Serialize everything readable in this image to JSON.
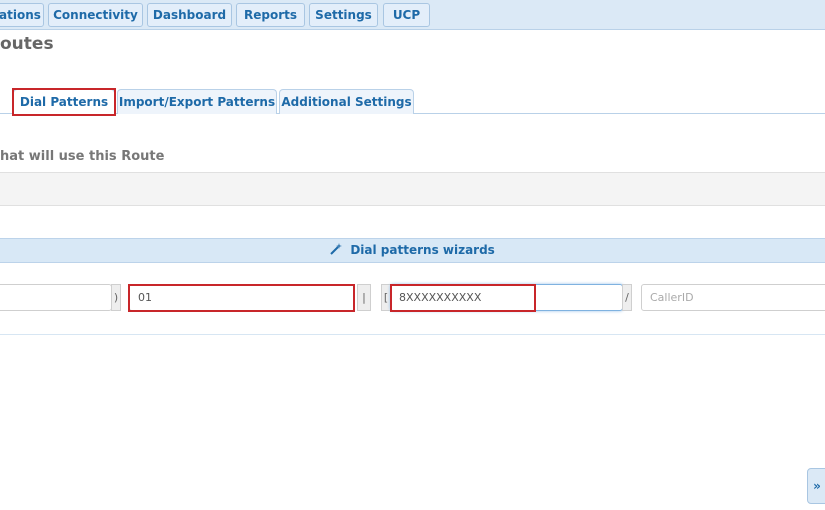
{
  "nav": {
    "items": [
      "ations",
      "Connectivity",
      "Dashboard",
      "Reports",
      "Settings",
      "UCP"
    ]
  },
  "page": {
    "title": "outes"
  },
  "tabs": {
    "dial_patterns": "Dial Patterns",
    "import_export": "Import/Export Patterns",
    "additional": "Additional Settings"
  },
  "section": {
    "heading": "hat will use this Route"
  },
  "wizard": {
    "label": "Dial patterns wizards",
    "icon": "magic-wand-icon"
  },
  "patterns": {
    "close_paren": ")",
    "prefix_value": "01",
    "pipe": "|",
    "open_bracket": "[",
    "match_value": "8XXXXXXXXXX",
    "slash": "/",
    "callerid_placeholder": "CallerID"
  },
  "side_toggle": {
    "label": "»"
  },
  "colors": {
    "accent": "#1e6aa8",
    "highlight": "#c8262a",
    "nav_bg": "#dbe9f6"
  }
}
